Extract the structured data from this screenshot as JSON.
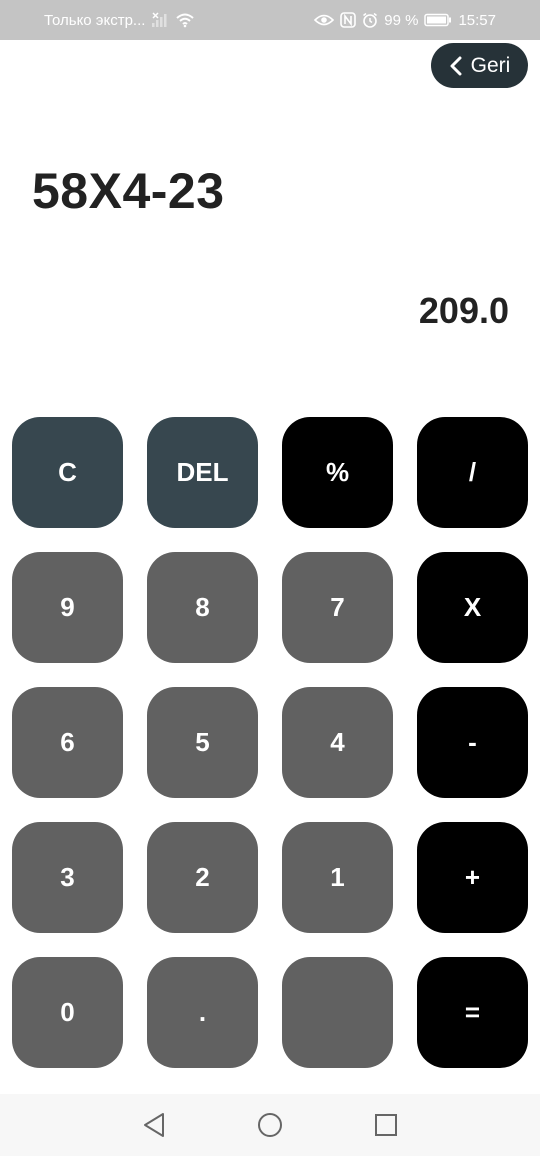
{
  "status_bar": {
    "carrier": "Только экстр...",
    "battery": "99 %",
    "time": "15:57"
  },
  "header": {
    "back_label": "Geri"
  },
  "display": {
    "expression": "58X4-23",
    "result": "209.0"
  },
  "keypad": {
    "rows": [
      [
        {
          "label": "C",
          "type": "func"
        },
        {
          "label": "DEL",
          "type": "func"
        },
        {
          "label": "%",
          "type": "op"
        },
        {
          "label": "/",
          "type": "op"
        }
      ],
      [
        {
          "label": "9",
          "type": "num"
        },
        {
          "label": "8",
          "type": "num"
        },
        {
          "label": "7",
          "type": "num"
        },
        {
          "label": "X",
          "type": "op"
        }
      ],
      [
        {
          "label": "6",
          "type": "num"
        },
        {
          "label": "5",
          "type": "num"
        },
        {
          "label": "4",
          "type": "num"
        },
        {
          "label": "-",
          "type": "op"
        }
      ],
      [
        {
          "label": "3",
          "type": "num"
        },
        {
          "label": "2",
          "type": "num"
        },
        {
          "label": "1",
          "type": "num"
        },
        {
          "label": "+",
          "type": "op"
        }
      ],
      [
        {
          "label": "0",
          "type": "num"
        },
        {
          "label": ".",
          "type": "num"
        },
        {
          "label": "",
          "type": "num"
        },
        {
          "label": "=",
          "type": "op"
        }
      ]
    ]
  },
  "colors": {
    "func_key": "#37474f",
    "op_key": "#000000",
    "num_key": "#616161",
    "back_button": "#263238",
    "text": "#222222"
  },
  "icons": {
    "back": "chevron-left-icon",
    "nav": [
      "triangle-back-icon",
      "circle-home-icon",
      "square-recents-icon"
    ]
  }
}
